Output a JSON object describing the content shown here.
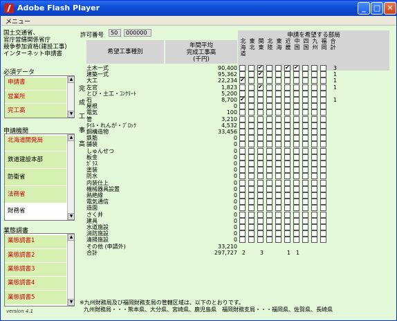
{
  "window": {
    "title": "Adobe Flash Player",
    "menu": "メニュー"
  },
  "left": {
    "info_lines": [
      "国土交通省、",
      "官庁営繕関係省庁",
      "競争参加資格(建設工事)",
      "インターネット申請書"
    ],
    "required_title": "必須データ",
    "required_items": [
      "申請書",
      "営業所",
      "完工高"
    ],
    "agency_title": "申請機関",
    "agency_items": [
      "北海道開発局",
      "鉄道建設本部",
      "防衛省",
      "法務省",
      "財務省"
    ],
    "survey_title": "業態調書",
    "survey_items": [
      "業態調書1",
      "業態調書2",
      "業態調書3",
      "業態調書4",
      "業態調書5"
    ],
    "version": "version 4.1"
  },
  "header": {
    "permit_label": "許可番号",
    "permit_code": "50",
    "permit_number": "000000",
    "col_type": "希望工事種別",
    "col_avg": "年間平均\n完成工事高\n(千円)",
    "dept_title": "申請を希望する部局",
    "vertical_label": [
      "完",
      "成",
      "工",
      "事",
      "高"
    ],
    "depts": [
      "北海道",
      "東北",
      "関東",
      "北陸",
      "東海",
      "近畿",
      "中国",
      "四国",
      "九州",
      "福岡",
      "合計"
    ]
  },
  "rows": [
    {
      "name": "土木一式",
      "value": "90,400",
      "checks": [
        0,
        0,
        1,
        0,
        0,
        1,
        1,
        0,
        0,
        0
      ],
      "total": "3"
    },
    {
      "name": "建築一式",
      "value": "95,362",
      "checks": [
        0,
        0,
        1,
        0,
        0,
        0,
        0,
        0,
        0,
        0
      ],
      "total": "1"
    },
    {
      "name": "大工",
      "value": "22,234",
      "checks": [
        1,
        0,
        0,
        0,
        0,
        0,
        0,
        0,
        0,
        0
      ],
      "total": "1"
    },
    {
      "name": "左官",
      "value": "1,823",
      "checks": [
        0,
        0,
        1,
        0,
        0,
        0,
        0,
        0,
        0,
        0
      ],
      "total": "1"
    },
    {
      "name": "とび・土工・ｺﾝｸﾘｰﾄ",
      "value": "5,200",
      "checks": [
        0,
        0,
        0,
        0,
        0,
        0,
        0,
        0,
        0,
        0
      ],
      "total": ""
    },
    {
      "name": "石",
      "value": "8,700",
      "checks": [
        1,
        0,
        0,
        0,
        0,
        0,
        0,
        0,
        0,
        0
      ],
      "total": "1"
    },
    {
      "name": "屋根",
      "value": "0",
      "checks": [
        0,
        0,
        0,
        0,
        0,
        0,
        0,
        0,
        0,
        0
      ],
      "total": ""
    },
    {
      "name": "電気",
      "value": "100",
      "checks": [
        0,
        0,
        0,
        0,
        0,
        0,
        0,
        0,
        0,
        0
      ],
      "total": ""
    },
    {
      "name": "管",
      "value": "3,210",
      "checks": [
        0,
        0,
        0,
        0,
        0,
        0,
        0,
        0,
        0,
        0
      ],
      "total": ""
    },
    {
      "name": "ﾀｲﾙ・れんが・ﾌﾞﾛｯｸ",
      "value": "4,532",
      "checks": [
        0,
        0,
        0,
        0,
        0,
        0,
        0,
        0,
        0,
        0
      ],
      "total": ""
    },
    {
      "name": "鋼構造物",
      "value": "33,456",
      "checks": [
        0,
        0,
        0,
        0,
        0,
        0,
        0,
        0,
        0,
        0
      ],
      "total": ""
    },
    {
      "name": "鉄筋",
      "value": "0",
      "checks": [
        0,
        0,
        0,
        0,
        0,
        0,
        0,
        0,
        0,
        0
      ],
      "total": ""
    },
    {
      "name": "舗装",
      "value": "0",
      "checks": [
        0,
        0,
        0,
        0,
        0,
        0,
        0,
        0,
        0,
        0
      ],
      "total": ""
    },
    {
      "name": "しゅんせつ",
      "value": "0",
      "checks": [
        0,
        0,
        0,
        0,
        0,
        0,
        0,
        0,
        0,
        0
      ],
      "total": ""
    },
    {
      "name": "板金",
      "value": "0",
      "checks": [
        0,
        0,
        0,
        0,
        0,
        0,
        0,
        0,
        0,
        0
      ],
      "total": ""
    },
    {
      "name": "ｶﾞﾗｽ",
      "value": "0",
      "checks": [
        0,
        0,
        0,
        0,
        0,
        0,
        0,
        0,
        0,
        0
      ],
      "total": ""
    },
    {
      "name": "塗装",
      "value": "0",
      "checks": [
        0,
        0,
        0,
        0,
        0,
        0,
        0,
        0,
        0,
        0
      ],
      "total": ""
    },
    {
      "name": "防水",
      "value": "0",
      "checks": [
        0,
        0,
        0,
        0,
        0,
        0,
        0,
        0,
        0,
        0
      ],
      "total": ""
    },
    {
      "name": "内装仕上",
      "value": "0",
      "checks": [
        0,
        0,
        0,
        0,
        0,
        0,
        0,
        0,
        0,
        0
      ],
      "total": ""
    },
    {
      "name": "機械器具設置",
      "value": "0",
      "checks": [
        0,
        0,
        0,
        0,
        0,
        0,
        0,
        0,
        0,
        0
      ],
      "total": ""
    },
    {
      "name": "熱絶縁",
      "value": "0",
      "checks": [
        0,
        0,
        0,
        0,
        0,
        0,
        0,
        0,
        0,
        0
      ],
      "total": ""
    },
    {
      "name": "電気通信",
      "value": "0",
      "checks": [
        0,
        0,
        0,
        0,
        0,
        0,
        0,
        0,
        0,
        0
      ],
      "total": ""
    },
    {
      "name": "造園",
      "value": "0",
      "checks": [
        0,
        0,
        0,
        0,
        0,
        0,
        0,
        0,
        0,
        0
      ],
      "total": ""
    },
    {
      "name": "さく井",
      "value": "0",
      "checks": [
        0,
        0,
        0,
        0,
        0,
        0,
        0,
        0,
        0,
        0
      ],
      "total": ""
    },
    {
      "name": "建具",
      "value": "0",
      "checks": [
        0,
        0,
        0,
        0,
        0,
        0,
        0,
        0,
        0,
        0
      ],
      "total": ""
    },
    {
      "name": "水道施設",
      "value": "0",
      "checks": [
        0,
        0,
        0,
        0,
        0,
        0,
        0,
        0,
        0,
        0
      ],
      "total": ""
    },
    {
      "name": "消防施設",
      "value": "0",
      "checks": [
        0,
        0,
        0,
        0,
        0,
        0,
        0,
        0,
        0,
        0
      ],
      "total": ""
    },
    {
      "name": "清掃施設",
      "value": "0",
      "checks": [
        0,
        0,
        0,
        0,
        0,
        0,
        0,
        0,
        0,
        0
      ],
      "total": ""
    }
  ],
  "other": {
    "name": "その他 (申請外)",
    "value": "33,210"
  },
  "total": {
    "name": "合計",
    "value": "297,727",
    "dept_totals": [
      "2",
      "",
      "3",
      "",
      "",
      "1",
      "1",
      "",
      "",
      ""
    ]
  },
  "footer": {
    "line1": "※九州財務局及び福岡財務支局の管轄区域は、以下のとおりです。",
    "line2": "九州財務局・・・熊本県、大分県、宮崎県、鹿児島県　福岡財務支局・・・福岡県、佐賀県、長崎県"
  }
}
